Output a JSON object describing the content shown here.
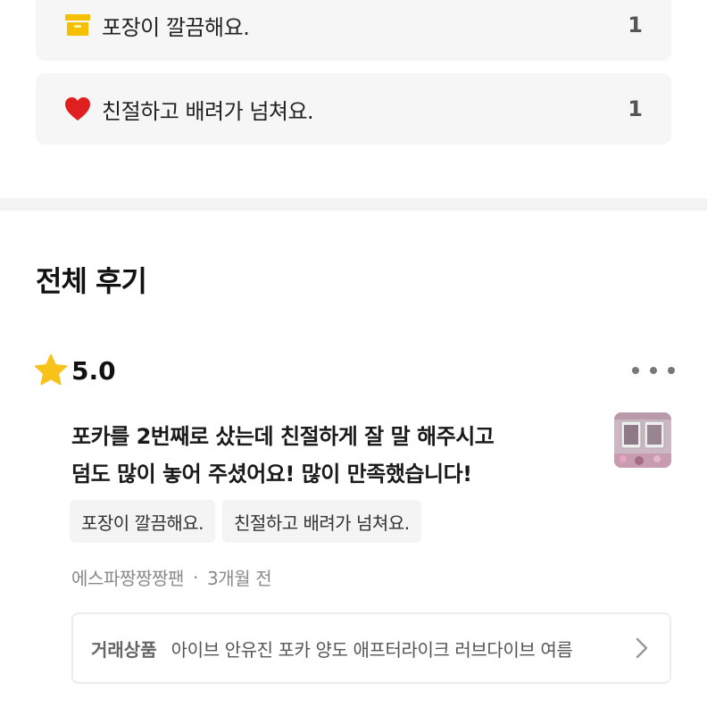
{
  "summary": {
    "items": [
      {
        "icon": "package-icon",
        "label": "포장이 깔끔해요.",
        "count": "1"
      },
      {
        "icon": "heart-icon",
        "label": "친절하고 배려가 넘쳐요.",
        "count": "1"
      }
    ]
  },
  "section": {
    "title": "전체 후기"
  },
  "review": {
    "rating": "5.0",
    "text_line1": "포카를 2번째로 샀는데 친절하게 잘 말 해주시고",
    "text_line2": "덤도 많이 놓어 주셨어요! 많이 만족했습니다!",
    "tags": [
      "포장이 깔끔해요.",
      "친절하고 배려가 넘쳐요."
    ],
    "author": "에스파짱짱짱팬",
    "separator": "·",
    "time": "3개월 전",
    "product_label": "거래상품",
    "product_name": "아이브 안유진 포카 양도 애프터라이크 러브다이브 여름"
  },
  "colors": {
    "star": "#f9c21b",
    "heart": "#e02020",
    "package": "#f5c000"
  }
}
